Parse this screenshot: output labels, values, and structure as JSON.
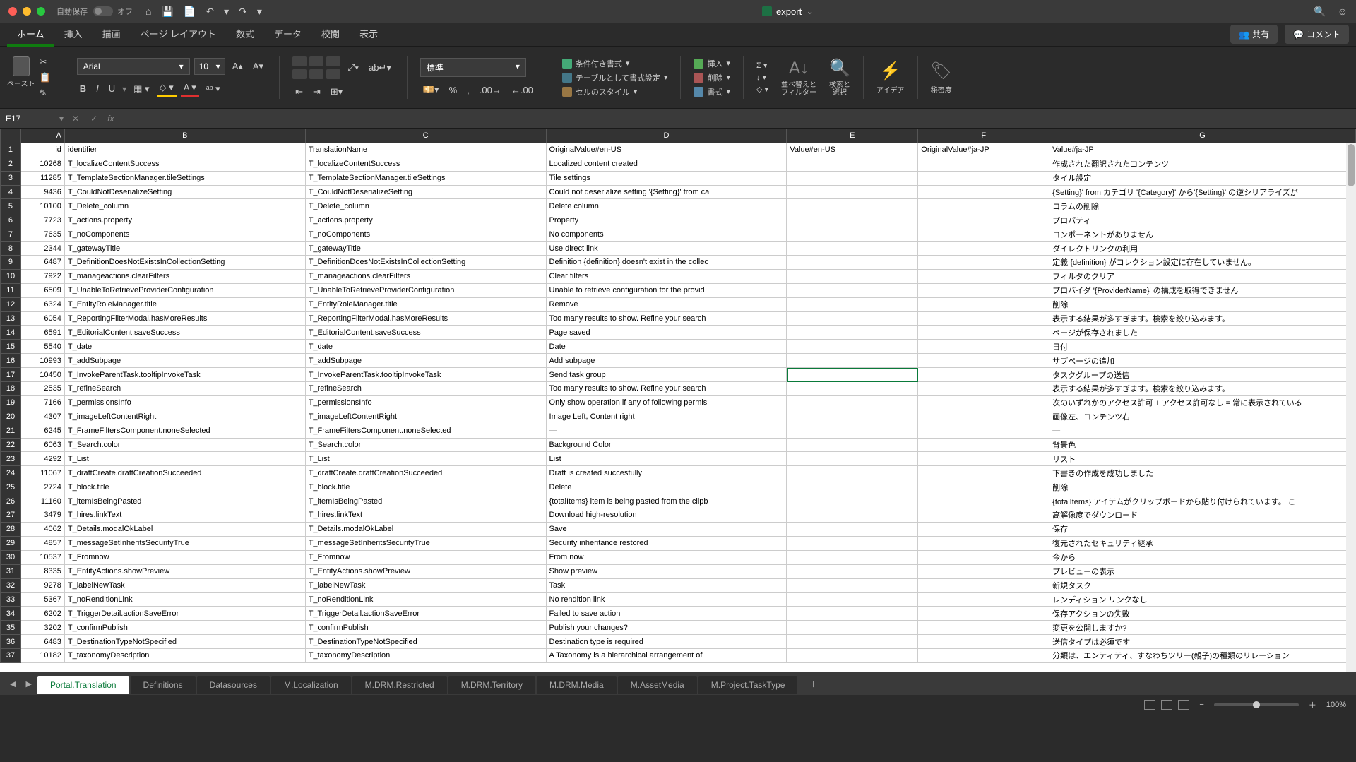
{
  "title": {
    "autosave": "自動保存",
    "autosave_state": "オフ",
    "docname": "export"
  },
  "menutabs": [
    "ホーム",
    "挿入",
    "描画",
    "ページ レイアウト",
    "数式",
    "データ",
    "校閲",
    "表示"
  ],
  "share": "共有",
  "comment": "コメント",
  "paste": "ペースト",
  "font": {
    "name": "Arial",
    "size": "10"
  },
  "numfmt": "標準",
  "styles": {
    "cond": "条件付き書式",
    "table": "テーブルとして書式設定",
    "cell": "セルのスタイル"
  },
  "cells": {
    "insert": "挿入",
    "delete": "削除",
    "format": "書式"
  },
  "edit": {
    "sort": "並べ替えと\nフィルター",
    "find": "検索と\n選択"
  },
  "idea": "アイデア",
  "secret": "秘密度",
  "namebox": "E17",
  "cols": [
    "",
    "A",
    "B",
    "C",
    "D",
    "E",
    "F",
    "G"
  ],
  "headers": [
    "id",
    "identifier",
    "TranslationName",
    "OriginalValue#en-US",
    "Value#en-US",
    "OriginalValue#ja-JP",
    "Value#ja-JP"
  ],
  "rows": [
    [
      10268,
      "T_localizeContentSuccess",
      "T_localizeContentSuccess",
      "Localized content created",
      "",
      "",
      "作成された翻訳されたコンテンツ"
    ],
    [
      11285,
      "T_TemplateSectionManager.tileSettings",
      "T_TemplateSectionManager.tileSettings",
      "Tile settings",
      "",
      "",
      "タイル設定"
    ],
    [
      9436,
      "T_CouldNotDeserializeSetting",
      "T_CouldNotDeserializeSetting",
      "Could not deserialize setting '{Setting}' from ca",
      "",
      "",
      "{Setting}' from カテゴリ '{Category}' から'{Setting}' の逆シリアライズが"
    ],
    [
      10100,
      "T_Delete_column",
      "T_Delete_column",
      "Delete column",
      "",
      "",
      "コラムの削除"
    ],
    [
      7723,
      "T_actions.property",
      "T_actions.property",
      "Property",
      "",
      "",
      "プロパティ"
    ],
    [
      7635,
      "T_noComponents",
      "T_noComponents",
      "No components",
      "",
      "",
      "コンポーネントがありません"
    ],
    [
      2344,
      "T_gatewayTitle",
      "T_gatewayTitle",
      "Use direct link",
      "",
      "",
      "ダイレクトリンクの利用"
    ],
    [
      6487,
      "T_DefinitionDoesNotExistsInCollectionSetting",
      "T_DefinitionDoesNotExistsInCollectionSetting",
      "Definition {definition} doesn't exist in the collec",
      "",
      "",
      "定義 {definition} がコレクション設定に存在していません。"
    ],
    [
      7922,
      "T_manageactions.clearFilters",
      "T_manageactions.clearFilters",
      "Clear filters",
      "",
      "",
      "フィルタのクリア"
    ],
    [
      6509,
      "T_UnableToRetrieveProviderConfiguration",
      "T_UnableToRetrieveProviderConfiguration",
      "Unable to retrieve configuration for the provid",
      "",
      "",
      "プロバイダ '{ProviderName}' の構成を取得できません"
    ],
    [
      6324,
      "T_EntityRoleManager.title",
      "T_EntityRoleManager.title",
      "Remove",
      "",
      "",
      "削除"
    ],
    [
      6054,
      "T_ReportingFilterModal.hasMoreResults",
      "T_ReportingFilterModal.hasMoreResults",
      "Too many results to show. Refine your search",
      "",
      "",
      "表示する結果が多すぎます。検索を絞り込みます。"
    ],
    [
      6591,
      "T_EditorialContent.saveSuccess",
      "T_EditorialContent.saveSuccess",
      "Page saved",
      "",
      "",
      "ページが保存されました"
    ],
    [
      5540,
      "T_date",
      "T_date",
      "Date",
      "",
      "",
      "日付"
    ],
    [
      10993,
      "T_addSubpage",
      "T_addSubpage",
      "Add subpage",
      "",
      "",
      "サブページの追加"
    ],
    [
      10450,
      "T_InvokeParentTask.tooltipInvokeTask",
      "T_InvokeParentTask.tooltipInvokeTask",
      "Send task group",
      "",
      "",
      "タスクグループの送信"
    ],
    [
      2535,
      "T_refineSearch",
      "T_refineSearch",
      "Too many results to show. Refine your search",
      "",
      "",
      "表示する結果が多すぎます。検索を絞り込みます。"
    ],
    [
      7166,
      "T_permissionsInfo",
      "T_permissionsInfo",
      "Only show operation if any of following permis",
      "",
      "",
      "次のいずれかのアクセス許可 + アクセス許可なし = 常に表示されている"
    ],
    [
      4307,
      "T_imageLeftContentRight",
      "T_imageLeftContentRight",
      "Image Left, Content right",
      "",
      "",
      "画像左、コンテンツ右"
    ],
    [
      6245,
      "T_FrameFiltersComponent.noneSelected",
      "T_FrameFiltersComponent.noneSelected",
      "—",
      "",
      "",
      "—"
    ],
    [
      6063,
      "T_Search.color",
      "T_Search.color",
      "Background Color",
      "",
      "",
      "背景色"
    ],
    [
      4292,
      "T_List",
      "T_List",
      "List",
      "",
      "",
      "リスト"
    ],
    [
      11067,
      "T_draftCreate.draftCreationSucceeded",
      "T_draftCreate.draftCreationSucceeded",
      "Draft is created succesfully",
      "",
      "",
      "下書きの作成を成功しました"
    ],
    [
      2724,
      "T_block.title",
      "T_block.title",
      "Delete",
      "",
      "",
      "削除"
    ],
    [
      11160,
      "T_itemIsBeingPasted",
      "T_itemIsBeingPasted",
      "{totalItems} item is being pasted from the clipb",
      "",
      "",
      "{totalItems} アイテムがクリップボードから貼り付けられています。 こ"
    ],
    [
      3479,
      "T_hires.linkText",
      "T_hires.linkText",
      "Download high-resolution",
      "",
      "",
      "高解像度でダウンロード"
    ],
    [
      4062,
      "T_Details.modalOkLabel",
      "T_Details.modalOkLabel",
      "Save",
      "",
      "",
      "保存"
    ],
    [
      4857,
      "T_messageSetInheritsSecurityTrue",
      "T_messageSetInheritsSecurityTrue",
      "Security inheritance restored",
      "",
      "",
      "復元されたセキュリティ継承"
    ],
    [
      10537,
      "T_Fromnow",
      "T_Fromnow",
      "From now",
      "",
      "",
      "今から"
    ],
    [
      8335,
      "T_EntityActions.showPreview",
      "T_EntityActions.showPreview",
      "Show preview",
      "",
      "",
      "プレビューの表示"
    ],
    [
      9278,
      "T_labelNewTask",
      "T_labelNewTask",
      "Task",
      "",
      "",
      "新規タスク"
    ],
    [
      5367,
      "T_noRenditionLink",
      "T_noRenditionLink",
      "No rendition link",
      "",
      "",
      "レンディション リンクなし"
    ],
    [
      6202,
      "T_TriggerDetail.actionSaveError",
      "T_TriggerDetail.actionSaveError",
      "Failed to save action",
      "",
      "",
      "保存アクションの失敗"
    ],
    [
      3202,
      "T_confirmPublish",
      "T_confirmPublish",
      "Publish your changes?",
      "",
      "",
      "変更を公開しますか?"
    ],
    [
      6483,
      "T_DestinationTypeNotSpecified",
      "T_DestinationTypeNotSpecified",
      "Destination type is required",
      "",
      "",
      "送信タイプは必須です"
    ],
    [
      10182,
      "T_taxonomyDescription",
      "T_taxonomyDescription",
      "A Taxonomy is a hierarchical arrangement of",
      "",
      "",
      "分類は、エンティティ、すなわちツリー(親子)の種類のリレーション"
    ]
  ],
  "sheets": [
    "Portal.Translation",
    "Definitions",
    "Datasources",
    "M.Localization",
    "M.DRM.Restricted",
    "M.DRM.Territory",
    "M.DRM.Media",
    "M.AssetMedia",
    "M.Project.TaskType"
  ],
  "active_sheet": 0,
  "zoom": "100%"
}
